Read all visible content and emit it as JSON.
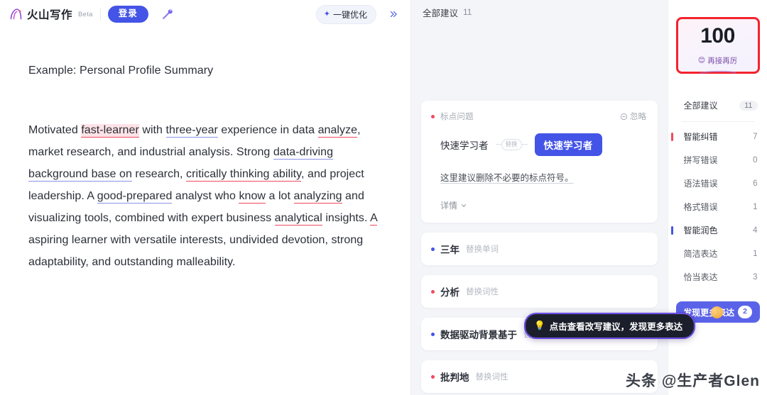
{
  "header": {
    "brand_name": "火山写作",
    "beta_label": "Beta",
    "login_label": "登录",
    "magic_icon": "magic-wand-icon",
    "optimize_label": "一键优化",
    "optimize_icon": "sparkle-icon",
    "collapse_icon": "double-chevron-right-icon"
  },
  "document": {
    "title": "Example: Personal Profile Summary",
    "segments": [
      {
        "text": "Motivated ",
        "mark": "none"
      },
      {
        "text": "fast-learner",
        "mark": "error-active"
      },
      {
        "text": " with ",
        "mark": "none"
      },
      {
        "text": "three-year",
        "mark": "polish"
      },
      {
        "text": " experience in data ",
        "mark": "none"
      },
      {
        "text": "analyze",
        "mark": "error"
      },
      {
        "text": ", market research, and industrial analysis. Strong ",
        "mark": "none"
      },
      {
        "text": "data-driving background base on",
        "mark": "polish"
      },
      {
        "text": " research, ",
        "mark": "none"
      },
      {
        "text": "critically thinking ability",
        "mark": "error"
      },
      {
        "text": ", and project leadership. A ",
        "mark": "none"
      },
      {
        "text": "good-prepared",
        "mark": "polish"
      },
      {
        "text": " analyst who ",
        "mark": "none"
      },
      {
        "text": "know",
        "mark": "error"
      },
      {
        "text": " a lot ",
        "mark": "none"
      },
      {
        "text": "analyzing",
        "mark": "error"
      },
      {
        "text": " and visualizing tools, combined with expert business ",
        "mark": "none"
      },
      {
        "text": "analytical",
        "mark": "error"
      },
      {
        "text": " insights. ",
        "mark": "none"
      },
      {
        "text": "A",
        "mark": "error"
      },
      {
        "text": " aspiring learner with versatile interests, undivided devotion, strong adaptability, and outstanding malleability.",
        "mark": "none"
      }
    ]
  },
  "suggestions": {
    "header_label": "全部建议",
    "header_count": "11",
    "expanded_card": {
      "type_label": "标点问题",
      "dot_color": "#ef4a5e",
      "ignore_label": "忽略",
      "ignore_icon": "circle-minus-icon",
      "from_text": "快速学习者",
      "replace_pill": "替换",
      "to_text": "快速学习者",
      "explanation": "这里建议删除不必要的标点符号。",
      "detail_label": "详情",
      "detail_icon": "chevron-down-icon"
    },
    "rows": [
      {
        "word": "三年",
        "tag": "替换单词",
        "dot_color": "#4354e6"
      },
      {
        "word": "分析",
        "tag": "替换词性",
        "dot_color": "#ef4a5e"
      },
      {
        "word": "数据驱动背景基于",
        "tag": "替换单词",
        "dot_color": "#4354e6"
      },
      {
        "word": "批判地",
        "tag": "替换词性",
        "dot_color": "#ef4a5e"
      }
    ],
    "tooltip": {
      "text": "点击查看改写建议，发现更多表达",
      "icon": "lightbulb-icon"
    }
  },
  "sidebar": {
    "score": {
      "value": "100",
      "caption": "再接再厉",
      "emoji": "😊",
      "highlight_color": "#f3232e"
    },
    "items": [
      {
        "label": "全部建议",
        "count": "11",
        "level": "all",
        "bar": "none"
      },
      {
        "label": "智能纠错",
        "count": "7",
        "level": "group",
        "bar": "red"
      },
      {
        "label": "拼写错误",
        "count": "0",
        "level": "sub",
        "bar": "none"
      },
      {
        "label": "语法错误",
        "count": "6",
        "level": "sub",
        "bar": "none"
      },
      {
        "label": "格式错误",
        "count": "1",
        "level": "sub",
        "bar": "none"
      },
      {
        "label": "智能润色",
        "count": "4",
        "level": "group",
        "bar": "blue"
      },
      {
        "label": "简洁表达",
        "count": "1",
        "level": "sub",
        "bar": "none"
      },
      {
        "label": "恰当表达",
        "count": "3",
        "level": "sub",
        "bar": "none"
      }
    ],
    "discover": {
      "label": "发现更多表达",
      "badge": "2"
    }
  },
  "watermark": {
    "text": "头条 @生产者Glen"
  }
}
